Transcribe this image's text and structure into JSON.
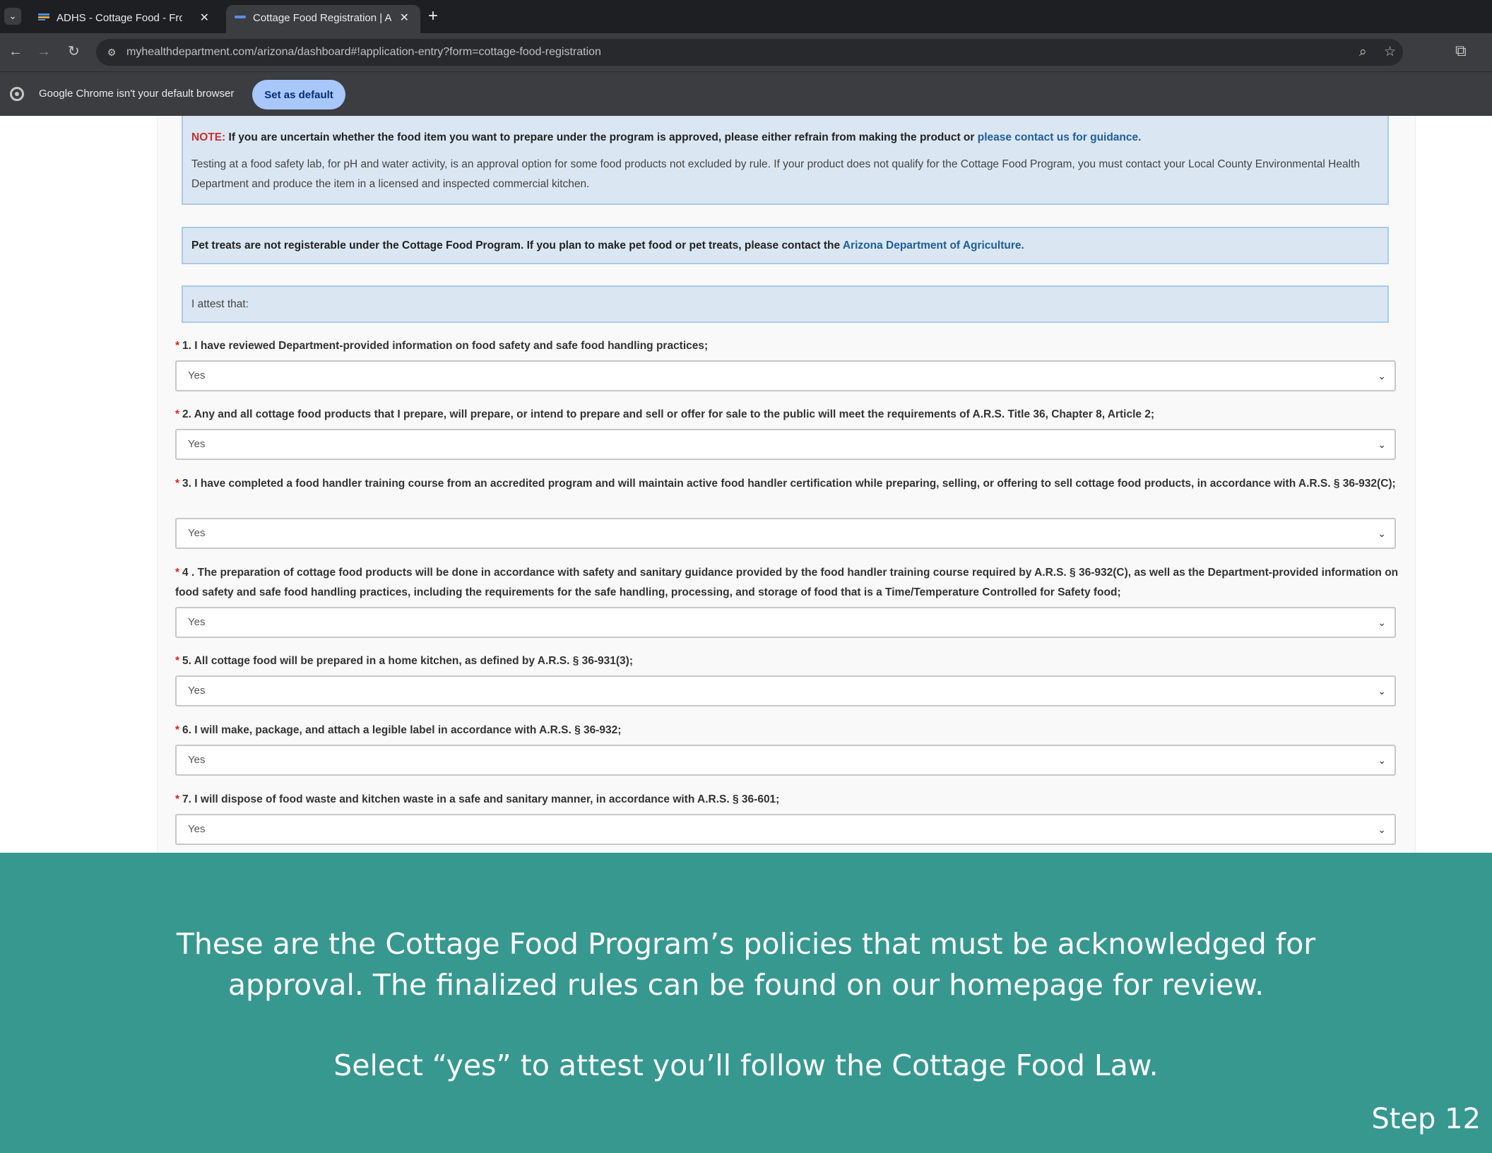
{
  "browser": {
    "tabs": [
      {
        "title": "ADHS - Cottage Food - Frosting",
        "active": false
      },
      {
        "title": "Cottage Food Registration | Arizona",
        "active": true
      }
    ],
    "url": "myhealthdepartment.com/arizona/dashboard#!application-entry?form=cottage-food-registration",
    "infobar_text": "Google Chrome isn't your default browser",
    "set_default_label": "Set as default"
  },
  "form": {
    "note": {
      "label": "NOTE:",
      "text": " If you are uncertain whether the food item you want to prepare under the program is approved, please either refrain from making the product or ",
      "link": "please contact us for guidance.",
      "testing": "Testing at a food safety lab, for pH and water activity, is an approval option for some food products not excluded by rule. If your product does not qualify for the Cottage Food Program, you must contact your Local County Environmental Health Department and produce the item in a licensed and inspected commercial kitchen."
    },
    "pet_note": {
      "text": "Pet treats are not registerable under the Cottage Food Program. If you plan to make pet food or pet treats, please contact the ",
      "link": "Arizona Department of Agriculture."
    },
    "attest_intro": "I attest that:",
    "required_marker": "*",
    "questions": [
      {
        "label": "1. I have reviewed Department-provided information on food safety and safe food handling practices;",
        "value": "Yes"
      },
      {
        "label": "2. Any and all cottage food products that I prepare, will prepare, or intend to prepare and sell or offer for sale to the public will meet the requirements of A.R.S. Title 36, Chapter 8, Article 2;",
        "value": "Yes"
      },
      {
        "label": "3. I have completed a food handler training course from an accredited program and will maintain active food handler certification while preparing, selling, or offering to sell cottage food products, in accordance with A.R.S. § 36-932(C);",
        "value": "Yes"
      },
      {
        "label": "4 . The preparation of cottage food products will be done in accordance with safety and sanitary guidance provided by the food handler training course required by A.R.S. § 36-932(C), as well as the Department-provided information on food safety and safe food handling practices, including the requirements for the safe handling, processing, and storage of food that is a Time/Temperature Controlled for Safety food;",
        "value": "Yes"
      },
      {
        "label": "5. All cottage food will be prepared in a home kitchen, as defined by A.R.S. § 36-931(3);",
        "value": "Yes"
      },
      {
        "label": "6. I will make, package, and attach a legible label in accordance with A.R.S. § 36-932;",
        "value": "Yes"
      },
      {
        "label": "7. I will dispose of food waste and kitchen waste in a safe and sanitary manner, in accordance with A.R.S. § 36-601;",
        "value": "Yes"
      }
    ]
  },
  "caption": {
    "line1": "These are the Cottage Food Program’s policies that must be acknowledged for",
    "line2": "approval. The finalized rules can be found on our homepage for review.",
    "line3": "Select “yes” to attest you’ll follow the Cottage Food Law.",
    "step": "Step 12"
  },
  "colors": {
    "banner": "#379890",
    "note_box": "#dae7f3",
    "link": "#1f5d99",
    "required": "#d9251c"
  }
}
